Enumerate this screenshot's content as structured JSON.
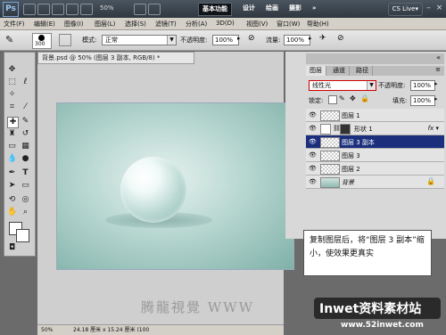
{
  "appbar": {
    "logo": "Ps",
    "zoom": "50%",
    "workspaces": [
      "基本功能",
      "设计",
      "绘画",
      "摄影"
    ],
    "more": "»",
    "cslive": "CS Live▾"
  },
  "menu": [
    "文件(F)",
    "编辑(E)",
    "图像(I)",
    "图层(L)",
    "选择(S)",
    "滤镜(T)",
    "分析(A)",
    "3D(D)",
    "视图(V)",
    "窗口(W)",
    "帮助(H)"
  ],
  "options": {
    "brush_size": "300",
    "mode_label": "模式:",
    "mode_value": "正常",
    "opacity_label": "不透明度:",
    "opacity_value": "100%",
    "flow_label": "流量:",
    "flow_value": "100%"
  },
  "document": {
    "tab_title": "背景.psd @ 50% (图层 3 副本, RGB/8) *",
    "status_zoom": "50%",
    "status_size": "24.18 厘米 x 15.24 厘米 (100"
  },
  "panel": {
    "tabs": [
      "图层",
      "通道",
      "路径"
    ],
    "blend_mode": "线性光",
    "opacity_label": "不透明度:",
    "opacity_value": "100%",
    "lock_label": "锁定:",
    "fill_label": "填充:",
    "fill_value": "100%",
    "layers": [
      {
        "name": "图层 1",
        "selected": false
      },
      {
        "name": "形状 1",
        "selected": false
      },
      {
        "name": "图层 3 副本",
        "selected": true
      },
      {
        "name": "图层 3",
        "selected": false
      },
      {
        "name": "图层 2",
        "selected": false
      },
      {
        "name": "背景",
        "selected": false
      }
    ]
  },
  "caption": "复制图层后，将“图层 3 副本”缩小，使效果更真实",
  "watermark": "腾龍視覺 WWW",
  "logo": {
    "text": "Inwet资料素材站",
    "url": "www.52inwet.com"
  }
}
